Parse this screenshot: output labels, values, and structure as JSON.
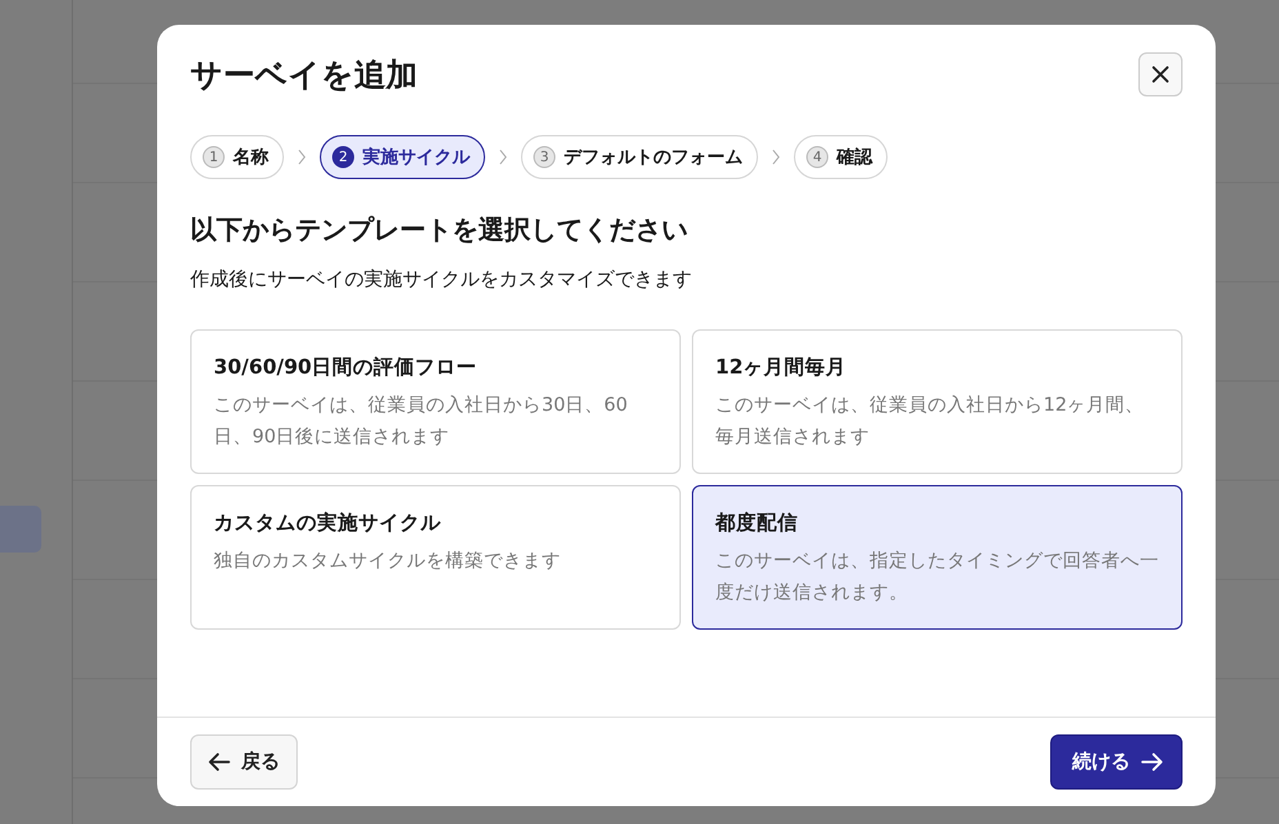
{
  "dialog": {
    "title": "サーベイを追加",
    "steps": [
      {
        "number": "1",
        "label": "名称",
        "selected": false
      },
      {
        "number": "2",
        "label": "実施サイクル",
        "selected": true
      },
      {
        "number": "3",
        "label": "デフォルトのフォーム",
        "selected": false
      },
      {
        "number": "4",
        "label": "確認",
        "selected": false
      }
    ],
    "heading": "以下からテンプレートを選択してください",
    "subtitle": "作成後にサーベイの実施サイクルをカスタマイズできます",
    "templates": [
      {
        "title": "30/60/90日間の評価フロー",
        "description": "このサーベイは、従業員の入社日から30日、60日、90日後に送信されます",
        "selected": false
      },
      {
        "title": "12ヶ月間毎月",
        "description": "このサーベイは、従業員の入社日から12ヶ月間、毎月送信されます",
        "selected": false
      },
      {
        "title": "カスタムの実施サイクル",
        "description": "独自のカスタムサイクルを構築できます",
        "selected": false
      },
      {
        "title": "都度配信",
        "description": "このサーベイは、指定したタイミングで回答者へ一度だけ送信されます。",
        "selected": true
      }
    ],
    "back_button": "戻る",
    "continue_button": "続ける"
  }
}
